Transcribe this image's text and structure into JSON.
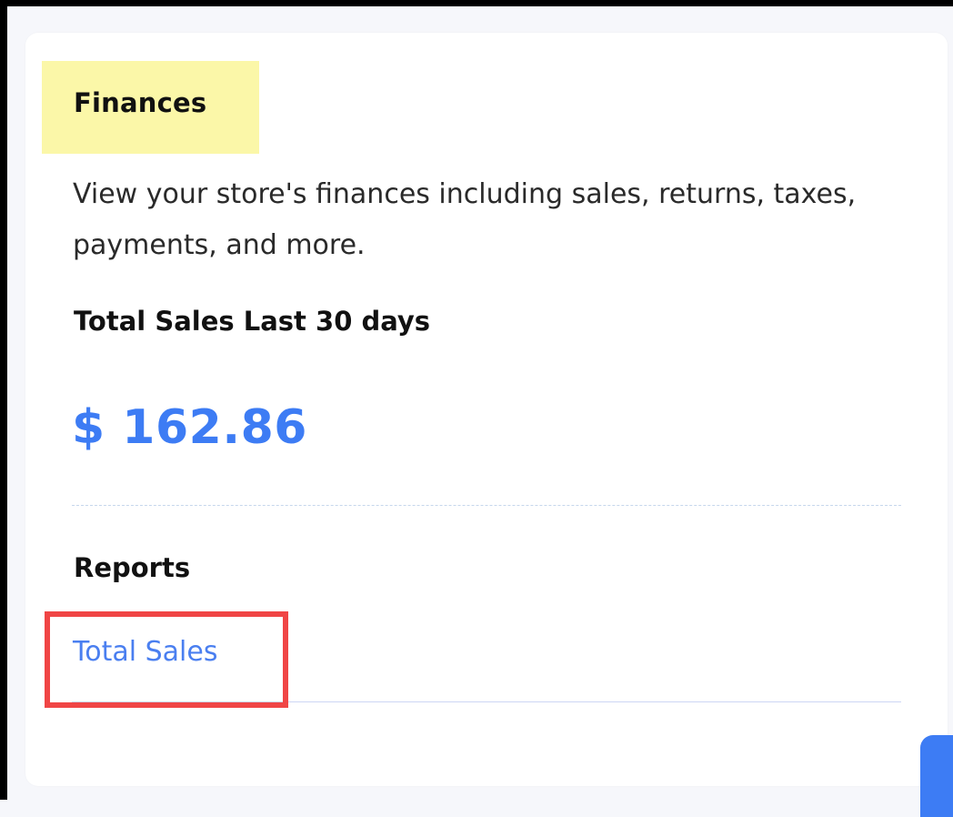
{
  "section": {
    "title": "Finances",
    "description": "View your store's finances including sales, returns, taxes, payments, and more."
  },
  "sales": {
    "label": "Total Sales Last 30 days",
    "value": "$ 162.86"
  },
  "reports": {
    "heading": "Reports",
    "links": [
      {
        "label": "Total Sales"
      }
    ]
  },
  "colors": {
    "accent": "#3d7cf4",
    "link": "#4a7ff0",
    "title_highlight": "#fbf7a8",
    "annotation": "#f04545"
  }
}
